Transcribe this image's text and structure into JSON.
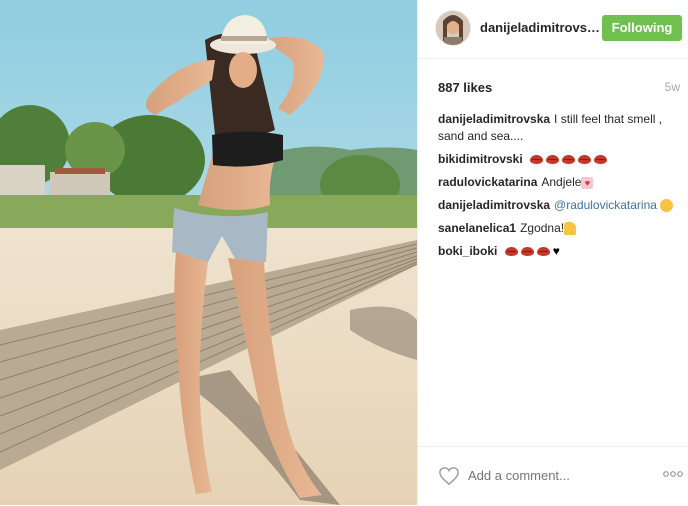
{
  "photo": {
    "alt_icon": "beach-photo"
  },
  "header": {
    "username": "danijeladimitrovska",
    "follow_label": "Following"
  },
  "stats": {
    "likes": "887 likes",
    "time": "5w"
  },
  "comments": [
    {
      "user": "danijeladimitrovska",
      "text": "I still feel that smell , sand and sea...."
    },
    {
      "user": "bikidimitrovski",
      "text": "",
      "emoji": "lips-icon x5"
    },
    {
      "user": "radulovickatarina",
      "text": "Andjele",
      "emoji": "heart-box-icon"
    },
    {
      "user": "danijeladimitrovska",
      "text": "@radulovickatarina",
      "emoji": "kiss-face-icon"
    },
    {
      "user": "sanelanelica1",
      "text": "Zgodna!",
      "emoji": "thumbs-up-icon"
    },
    {
      "user": "boki_iboki",
      "text": "",
      "emoji": "lips-icon x3, black-heart-icon"
    }
  ],
  "footer": {
    "comment_placeholder": "Add a comment...",
    "more_icon": "ellipsis-icon"
  },
  "colors": {
    "follow": "#70c050",
    "mention": "#3f729b",
    "muted": "#a5a7aa"
  }
}
